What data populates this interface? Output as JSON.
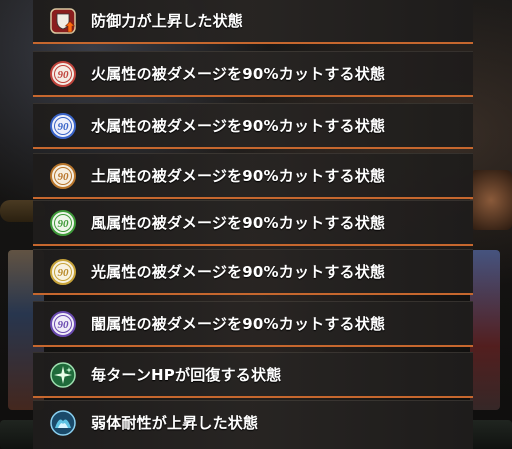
{
  "status_list": {
    "items": [
      {
        "label": "防御力が上昇した状態",
        "icon": "defense-up-icon"
      },
      {
        "label": "火属性の被ダメージを90%カットする状態",
        "icon": "fire-cut-90-icon",
        "badge": "90",
        "color": "#c0443c"
      },
      {
        "label": "水属性の被ダメージを90%カットする状態",
        "icon": "water-cut-90-icon",
        "badge": "90",
        "color": "#3a64c8"
      },
      {
        "label": "土属性の被ダメージを90%カットする状態",
        "icon": "earth-cut-90-icon",
        "badge": "90",
        "color": "#b8762c"
      },
      {
        "label": "風属性の被ダメージを90%カットする状態",
        "icon": "wind-cut-90-icon",
        "badge": "90",
        "color": "#3f9a3a"
      },
      {
        "label": "光属性の被ダメージを90%カットする状態",
        "icon": "light-cut-90-icon",
        "badge": "90",
        "color": "#c8a43a"
      },
      {
        "label": "闇属性の被ダメージを90%カットする状態",
        "icon": "dark-cut-90-icon",
        "badge": "90",
        "color": "#6a4ab0"
      },
      {
        "label": "毎ターンHPが回復する状態",
        "icon": "regen-icon"
      },
      {
        "label": "弱体耐性が上昇した状態",
        "icon": "debuff-resist-up-icon"
      }
    ]
  }
}
